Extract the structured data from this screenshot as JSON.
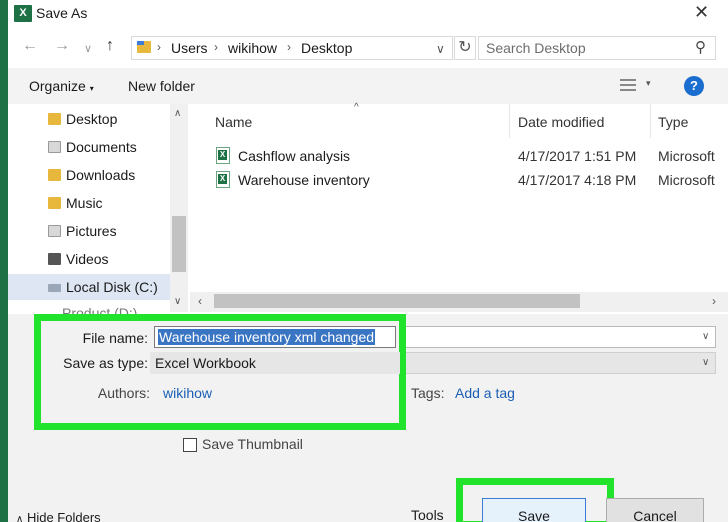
{
  "window": {
    "title": "Save As",
    "app_icon": "excel-icon"
  },
  "nav": {
    "breadcrumbs": [
      "Users",
      "wikihow",
      "Desktop"
    ],
    "search_placeholder": "Search Desktop"
  },
  "toolbar": {
    "organize": "Organize",
    "new_folder": "New folder",
    "help": "?"
  },
  "sidebar": {
    "items": [
      {
        "label": "Desktop",
        "icon": "desktop-folder-icon"
      },
      {
        "label": "Documents",
        "icon": "documents-folder-icon"
      },
      {
        "label": "Downloads",
        "icon": "downloads-folder-icon"
      },
      {
        "label": "Music",
        "icon": "music-folder-icon"
      },
      {
        "label": "Pictures",
        "icon": "pictures-folder-icon"
      },
      {
        "label": "Videos",
        "icon": "videos-folder-icon"
      },
      {
        "label": "Local Disk (C:)",
        "icon": "drive-icon",
        "selected": true
      }
    ],
    "partial_item": "Product (D:)"
  },
  "file_list": {
    "columns": {
      "name": "Name",
      "date": "Date modified",
      "type": "Type"
    },
    "files": [
      {
        "name": "Cashflow analysis",
        "date": "4/17/2017 1:51 PM",
        "type": "Microsoft"
      },
      {
        "name": "Warehouse inventory",
        "date": "4/17/2017 4:18 PM",
        "type": "Microsoft"
      }
    ]
  },
  "form": {
    "file_name_label": "File name:",
    "file_name_value": "Warehouse inventory xml changed",
    "save_type_label": "Save as type:",
    "save_type_value": "Excel Workbook",
    "authors_label": "Authors:",
    "authors_value": "wikihow",
    "tags_label": "Tags:",
    "tags_value": "Add a tag",
    "thumbnail_label": "Save Thumbnail"
  },
  "footer": {
    "hide_folders": "Hide Folders",
    "tools": "Tools",
    "save": "Save",
    "cancel": "Cancel"
  },
  "colors": {
    "highlight": "#22e32c",
    "excel_green": "#1e7145",
    "link": "#1a5fb4",
    "selection": "#3a75c4"
  }
}
